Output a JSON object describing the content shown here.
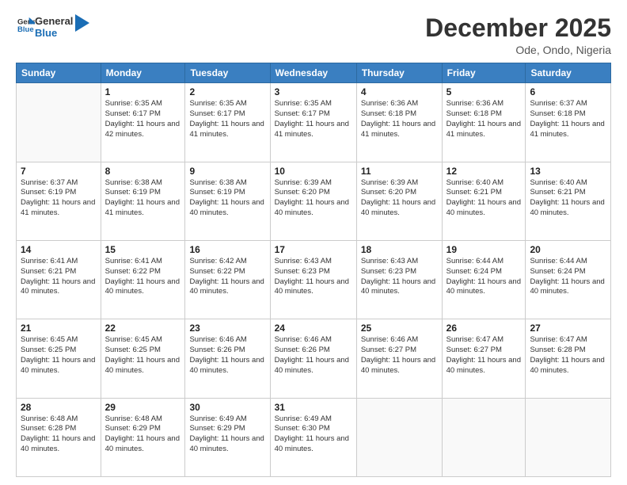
{
  "header": {
    "logo_general": "General",
    "logo_blue": "Blue",
    "month_title": "December 2025",
    "location": "Ode, Ondo, Nigeria"
  },
  "weekdays": [
    "Sunday",
    "Monday",
    "Tuesday",
    "Wednesday",
    "Thursday",
    "Friday",
    "Saturday"
  ],
  "weeks": [
    [
      {
        "day": "",
        "sunrise": "",
        "sunset": "",
        "daylight": ""
      },
      {
        "day": "1",
        "sunrise": "Sunrise: 6:35 AM",
        "sunset": "Sunset: 6:17 PM",
        "daylight": "Daylight: 11 hours and 42 minutes."
      },
      {
        "day": "2",
        "sunrise": "Sunrise: 6:35 AM",
        "sunset": "Sunset: 6:17 PM",
        "daylight": "Daylight: 11 hours and 41 minutes."
      },
      {
        "day": "3",
        "sunrise": "Sunrise: 6:35 AM",
        "sunset": "Sunset: 6:17 PM",
        "daylight": "Daylight: 11 hours and 41 minutes."
      },
      {
        "day": "4",
        "sunrise": "Sunrise: 6:36 AM",
        "sunset": "Sunset: 6:18 PM",
        "daylight": "Daylight: 11 hours and 41 minutes."
      },
      {
        "day": "5",
        "sunrise": "Sunrise: 6:36 AM",
        "sunset": "Sunset: 6:18 PM",
        "daylight": "Daylight: 11 hours and 41 minutes."
      },
      {
        "day": "6",
        "sunrise": "Sunrise: 6:37 AM",
        "sunset": "Sunset: 6:18 PM",
        "daylight": "Daylight: 11 hours and 41 minutes."
      }
    ],
    [
      {
        "day": "7",
        "sunrise": "Sunrise: 6:37 AM",
        "sunset": "Sunset: 6:19 PM",
        "daylight": "Daylight: 11 hours and 41 minutes."
      },
      {
        "day": "8",
        "sunrise": "Sunrise: 6:38 AM",
        "sunset": "Sunset: 6:19 PM",
        "daylight": "Daylight: 11 hours and 41 minutes."
      },
      {
        "day": "9",
        "sunrise": "Sunrise: 6:38 AM",
        "sunset": "Sunset: 6:19 PM",
        "daylight": "Daylight: 11 hours and 40 minutes."
      },
      {
        "day": "10",
        "sunrise": "Sunrise: 6:39 AM",
        "sunset": "Sunset: 6:20 PM",
        "daylight": "Daylight: 11 hours and 40 minutes."
      },
      {
        "day": "11",
        "sunrise": "Sunrise: 6:39 AM",
        "sunset": "Sunset: 6:20 PM",
        "daylight": "Daylight: 11 hours and 40 minutes."
      },
      {
        "day": "12",
        "sunrise": "Sunrise: 6:40 AM",
        "sunset": "Sunset: 6:21 PM",
        "daylight": "Daylight: 11 hours and 40 minutes."
      },
      {
        "day": "13",
        "sunrise": "Sunrise: 6:40 AM",
        "sunset": "Sunset: 6:21 PM",
        "daylight": "Daylight: 11 hours and 40 minutes."
      }
    ],
    [
      {
        "day": "14",
        "sunrise": "Sunrise: 6:41 AM",
        "sunset": "Sunset: 6:21 PM",
        "daylight": "Daylight: 11 hours and 40 minutes."
      },
      {
        "day": "15",
        "sunrise": "Sunrise: 6:41 AM",
        "sunset": "Sunset: 6:22 PM",
        "daylight": "Daylight: 11 hours and 40 minutes."
      },
      {
        "day": "16",
        "sunrise": "Sunrise: 6:42 AM",
        "sunset": "Sunset: 6:22 PM",
        "daylight": "Daylight: 11 hours and 40 minutes."
      },
      {
        "day": "17",
        "sunrise": "Sunrise: 6:43 AM",
        "sunset": "Sunset: 6:23 PM",
        "daylight": "Daylight: 11 hours and 40 minutes."
      },
      {
        "day": "18",
        "sunrise": "Sunrise: 6:43 AM",
        "sunset": "Sunset: 6:23 PM",
        "daylight": "Daylight: 11 hours and 40 minutes."
      },
      {
        "day": "19",
        "sunrise": "Sunrise: 6:44 AM",
        "sunset": "Sunset: 6:24 PM",
        "daylight": "Daylight: 11 hours and 40 minutes."
      },
      {
        "day": "20",
        "sunrise": "Sunrise: 6:44 AM",
        "sunset": "Sunset: 6:24 PM",
        "daylight": "Daylight: 11 hours and 40 minutes."
      }
    ],
    [
      {
        "day": "21",
        "sunrise": "Sunrise: 6:45 AM",
        "sunset": "Sunset: 6:25 PM",
        "daylight": "Daylight: 11 hours and 40 minutes."
      },
      {
        "day": "22",
        "sunrise": "Sunrise: 6:45 AM",
        "sunset": "Sunset: 6:25 PM",
        "daylight": "Daylight: 11 hours and 40 minutes."
      },
      {
        "day": "23",
        "sunrise": "Sunrise: 6:46 AM",
        "sunset": "Sunset: 6:26 PM",
        "daylight": "Daylight: 11 hours and 40 minutes."
      },
      {
        "day": "24",
        "sunrise": "Sunrise: 6:46 AM",
        "sunset": "Sunset: 6:26 PM",
        "daylight": "Daylight: 11 hours and 40 minutes."
      },
      {
        "day": "25",
        "sunrise": "Sunrise: 6:46 AM",
        "sunset": "Sunset: 6:27 PM",
        "daylight": "Daylight: 11 hours and 40 minutes."
      },
      {
        "day": "26",
        "sunrise": "Sunrise: 6:47 AM",
        "sunset": "Sunset: 6:27 PM",
        "daylight": "Daylight: 11 hours and 40 minutes."
      },
      {
        "day": "27",
        "sunrise": "Sunrise: 6:47 AM",
        "sunset": "Sunset: 6:28 PM",
        "daylight": "Daylight: 11 hours and 40 minutes."
      }
    ],
    [
      {
        "day": "28",
        "sunrise": "Sunrise: 6:48 AM",
        "sunset": "Sunset: 6:28 PM",
        "daylight": "Daylight: 11 hours and 40 minutes."
      },
      {
        "day": "29",
        "sunrise": "Sunrise: 6:48 AM",
        "sunset": "Sunset: 6:29 PM",
        "daylight": "Daylight: 11 hours and 40 minutes."
      },
      {
        "day": "30",
        "sunrise": "Sunrise: 6:49 AM",
        "sunset": "Sunset: 6:29 PM",
        "daylight": "Daylight: 11 hours and 40 minutes."
      },
      {
        "day": "31",
        "sunrise": "Sunrise: 6:49 AM",
        "sunset": "Sunset: 6:30 PM",
        "daylight": "Daylight: 11 hours and 40 minutes."
      },
      {
        "day": "",
        "sunrise": "",
        "sunset": "",
        "daylight": ""
      },
      {
        "day": "",
        "sunrise": "",
        "sunset": "",
        "daylight": ""
      },
      {
        "day": "",
        "sunrise": "",
        "sunset": "",
        "daylight": ""
      }
    ]
  ]
}
